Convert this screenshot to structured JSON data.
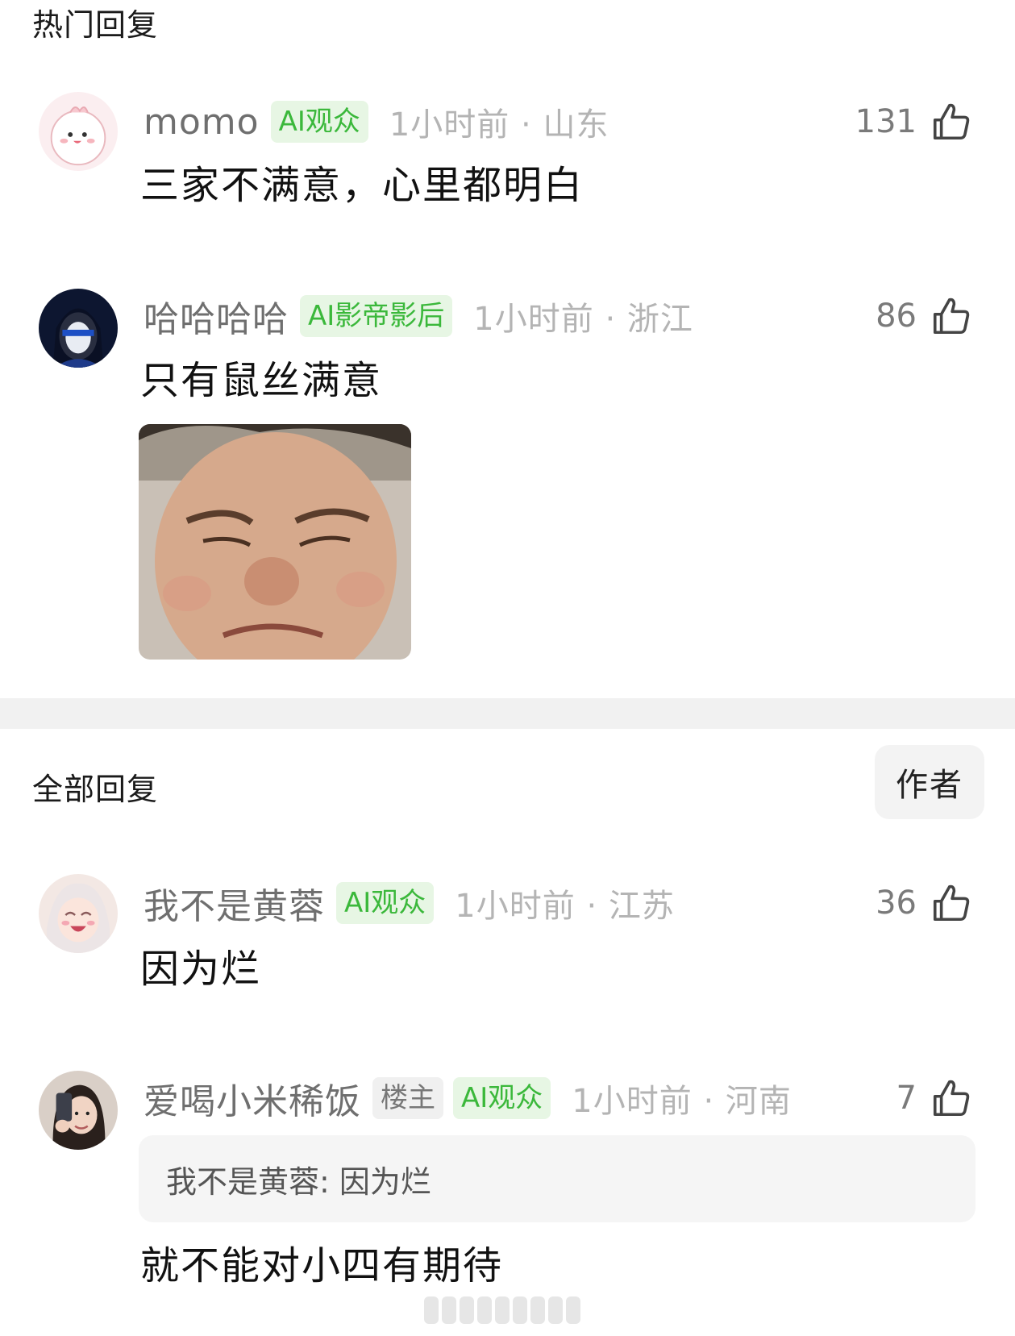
{
  "hot_section": {
    "title": "热门回复"
  },
  "all_section": {
    "title": "全部回复",
    "author_filter_label": "作者"
  },
  "hot_comments": [
    {
      "username": "momo",
      "badges": [
        "AI观众"
      ],
      "time_location": "1小时前 · 山东",
      "likes": "131",
      "text": "三家不满意，心里都明白"
    },
    {
      "username": "哈哈哈哈",
      "badges": [
        "AI影帝影后"
      ],
      "time_location": "1小时前 · 浙江",
      "likes": "86",
      "text": "只有鼠丝满意",
      "has_image": true
    }
  ],
  "all_comments": [
    {
      "username": "我不是黄蓉",
      "badges": [
        "AI观众"
      ],
      "time_location": "1小时前 · 江苏",
      "likes": "36",
      "text": "因为烂"
    },
    {
      "username": "爱喝小米稀饭",
      "owner_badge": "楼主",
      "badges": [
        "AI观众"
      ],
      "time_location": "1小时前 · 河南",
      "likes": "7",
      "quote": "我不是黄蓉: 因为烂",
      "text": "就不能对小四有期待"
    }
  ],
  "icons": {
    "like": "thumbs-up-icon"
  },
  "colors": {
    "ai_badge_bg": "#e7f6e4",
    "ai_badge_text": "#3bb83b",
    "divider": "#f1f1f1"
  }
}
